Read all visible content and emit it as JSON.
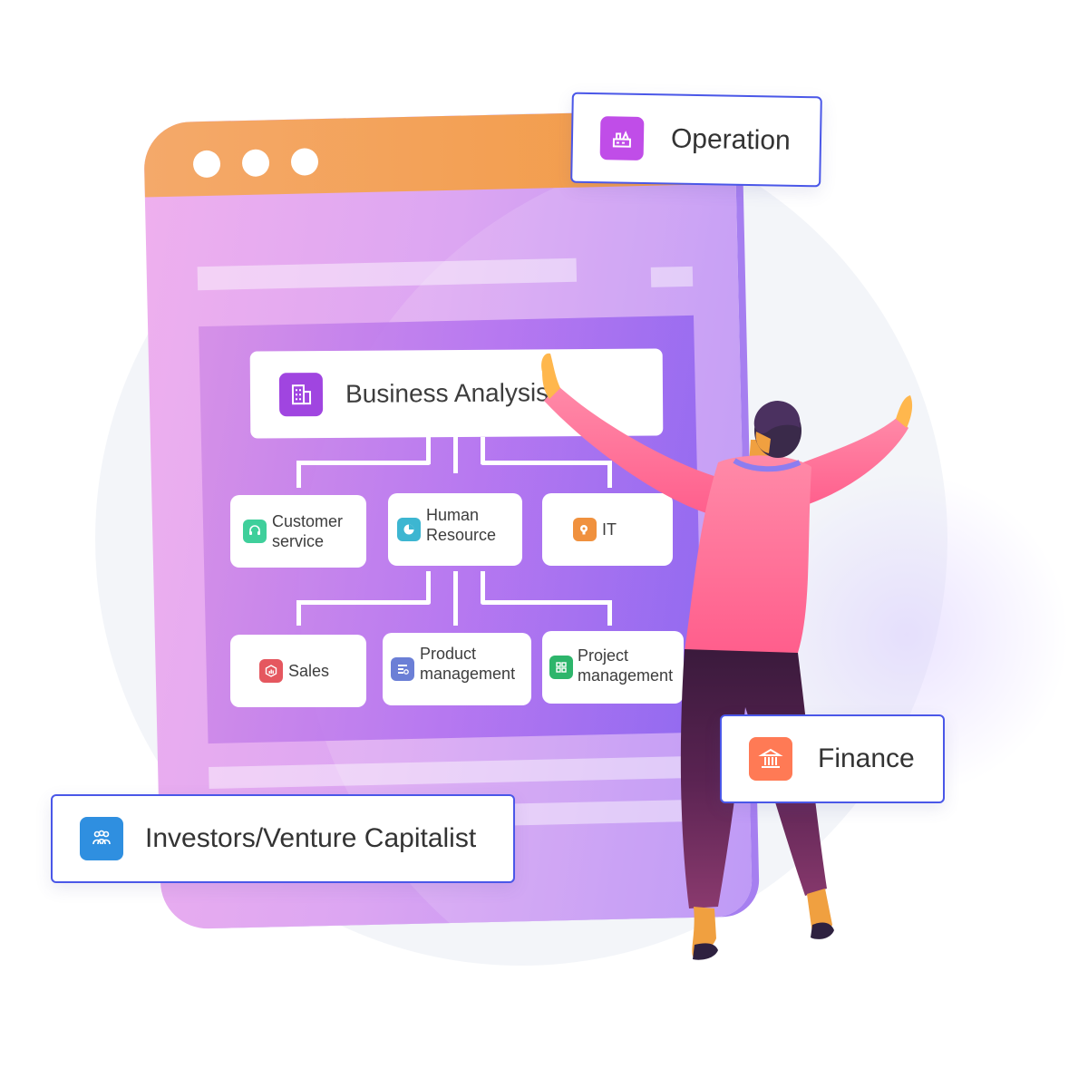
{
  "window": {
    "dots": 3
  },
  "business_analysis": {
    "label": "Business Analysis"
  },
  "departments_row1": [
    {
      "label_line1": "Customer",
      "label_line2": "service",
      "icon": "headset-icon",
      "color": "#3fcf9b"
    },
    {
      "label_line1": "Human",
      "label_line2": "Resource",
      "icon": "pie-chart-icon",
      "color": "#3db6d1"
    },
    {
      "label_line1": "IT",
      "label_line2": "",
      "icon": "lightbulb-gear-icon",
      "color": "#f0913e"
    }
  ],
  "departments_row2": [
    {
      "label_line1": "Sales",
      "label_line2": "",
      "icon": "sales-chart-icon",
      "color": "#e5575f"
    },
    {
      "label_line1": "Product",
      "label_line2": "management",
      "icon": "product-settings-icon",
      "color": "#6b7fd6"
    },
    {
      "label_line1": "Project",
      "label_line2": "management",
      "icon": "grid-icon",
      "color": "#2db56b"
    }
  ],
  "floating": {
    "operation": {
      "label": "Operation",
      "icon": "factory-icon",
      "color": "#c04de8"
    },
    "finance": {
      "label": "Finance",
      "icon": "bank-icon",
      "color": "#ff7a55"
    },
    "investors": {
      "label": "Investors/Venture Capitalist",
      "icon": "people-group-icon",
      "color": "#2f8fe0"
    }
  },
  "colors": {
    "titlebar": "#f29a45",
    "window": "#dca6f2",
    "accent_border": "#4a57e8",
    "business_icon": "#a045e0"
  }
}
